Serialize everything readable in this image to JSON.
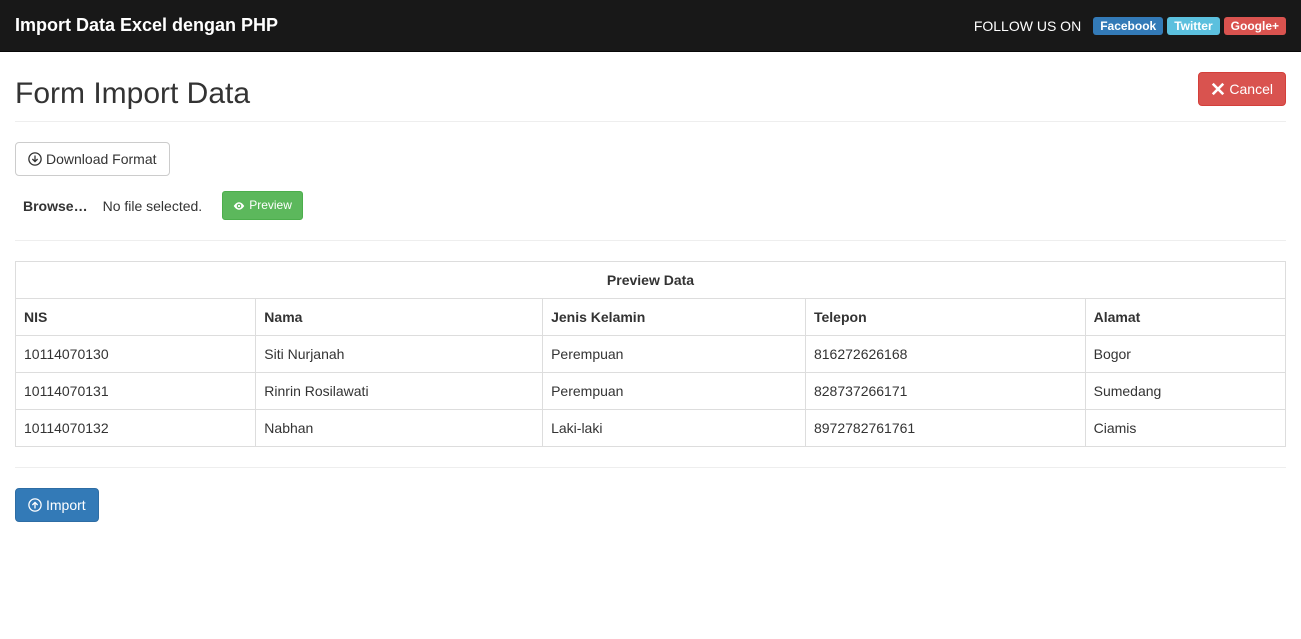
{
  "navbar": {
    "brand": "Import Data Excel dengan PHP",
    "follow_text": "FOLLOW US ON",
    "social": {
      "facebook": "Facebook",
      "twitter": "Twitter",
      "google": "Google+"
    }
  },
  "header": {
    "title": "Form Import Data",
    "cancel_label": "Cancel"
  },
  "actions": {
    "download_format": "Download Format",
    "browse_label": "Browse…",
    "no_file_text": "No file selected.",
    "preview_label": "Preview",
    "import_label": "Import"
  },
  "table": {
    "title": "Preview Data",
    "headers": {
      "nis": "NIS",
      "nama": "Nama",
      "jenis_kelamin": "Jenis Kelamin",
      "telepon": "Telepon",
      "alamat": "Alamat"
    },
    "rows": [
      {
        "nis": "10114070130",
        "nama": "Siti Nurjanah",
        "jenis_kelamin": "Perempuan",
        "telepon": "816272626168",
        "alamat": "Bogor"
      },
      {
        "nis": "10114070131",
        "nama": "Rinrin Rosilawati",
        "jenis_kelamin": "Perempuan",
        "telepon": "828737266171",
        "alamat": "Sumedang"
      },
      {
        "nis": "10114070132",
        "nama": "Nabhan",
        "jenis_kelamin": "Laki-laki",
        "telepon": "8972782761761",
        "alamat": "Ciamis"
      }
    ]
  }
}
